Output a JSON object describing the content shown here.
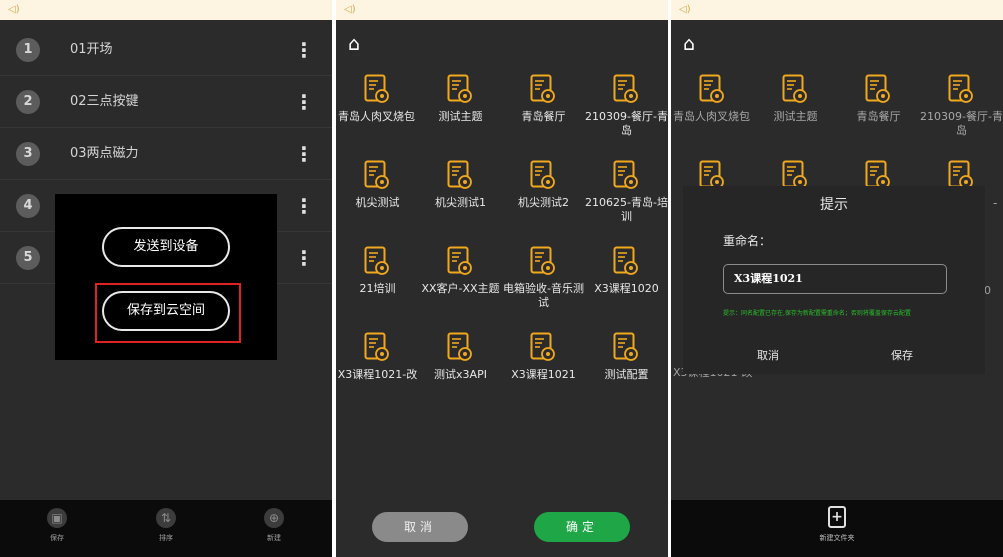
{
  "colors": {
    "accent_orange": "#f0a81e",
    "confirm_green": "#1ea647",
    "highlight_red": "#e02222",
    "hint_green": "#2cbf2c"
  },
  "panel1": {
    "items": [
      {
        "num": "1",
        "label": "01开场"
      },
      {
        "num": "2",
        "label": "02三点按键"
      },
      {
        "num": "3",
        "label": "03两点磁力"
      },
      {
        "num": "4",
        "label": ""
      },
      {
        "num": "5",
        "label": ""
      }
    ],
    "kebab": "⋮",
    "popup": {
      "send_label": "发送到设备",
      "save_label": "保存到云空间"
    },
    "bottom": {
      "save_label": "保存",
      "sort_label": "排序",
      "new_label": "新建"
    }
  },
  "panel2": {
    "tiles": [
      {
        "name": "青岛人肉叉烧包"
      },
      {
        "name": "测试主题"
      },
      {
        "name": "青岛餐厅"
      },
      {
        "name": "210309-餐厅-青岛"
      },
      {
        "name": "机尖测试"
      },
      {
        "name": "机尖测试1"
      },
      {
        "name": "机尖测试2"
      },
      {
        "name": "210625-青岛-培训"
      },
      {
        "name": "21培训"
      },
      {
        "name": "XX客户-XX主题"
      },
      {
        "name": "电箱验收-音乐测试"
      },
      {
        "name": "X3课程1020"
      },
      {
        "name": "X3课程1021-改"
      },
      {
        "name": "测试x3API"
      },
      {
        "name": "X3课程1021"
      },
      {
        "name": "测试配置"
      }
    ],
    "cancel_label": "取消",
    "ok_label": "确定"
  },
  "panel3": {
    "tiles_row1": [
      "青岛人肉叉烧包",
      "测试主题",
      "青岛餐厅",
      "210309-餐厅-青岛"
    ],
    "dialog": {
      "title": "提示",
      "label": "重命名：",
      "input_value": "X3课程1021",
      "hint": "提示：同名配置已存在,保存为新配置需重命名；否则将覆盖保存云配置",
      "cancel_label": "取消",
      "save_label": "保存"
    },
    "edge_text": {
      "right_dash": "-",
      "right_zero": "0",
      "peek_row": "X3课程1021-改"
    },
    "bottom": {
      "new_folder_label": "新建文件夹"
    }
  }
}
